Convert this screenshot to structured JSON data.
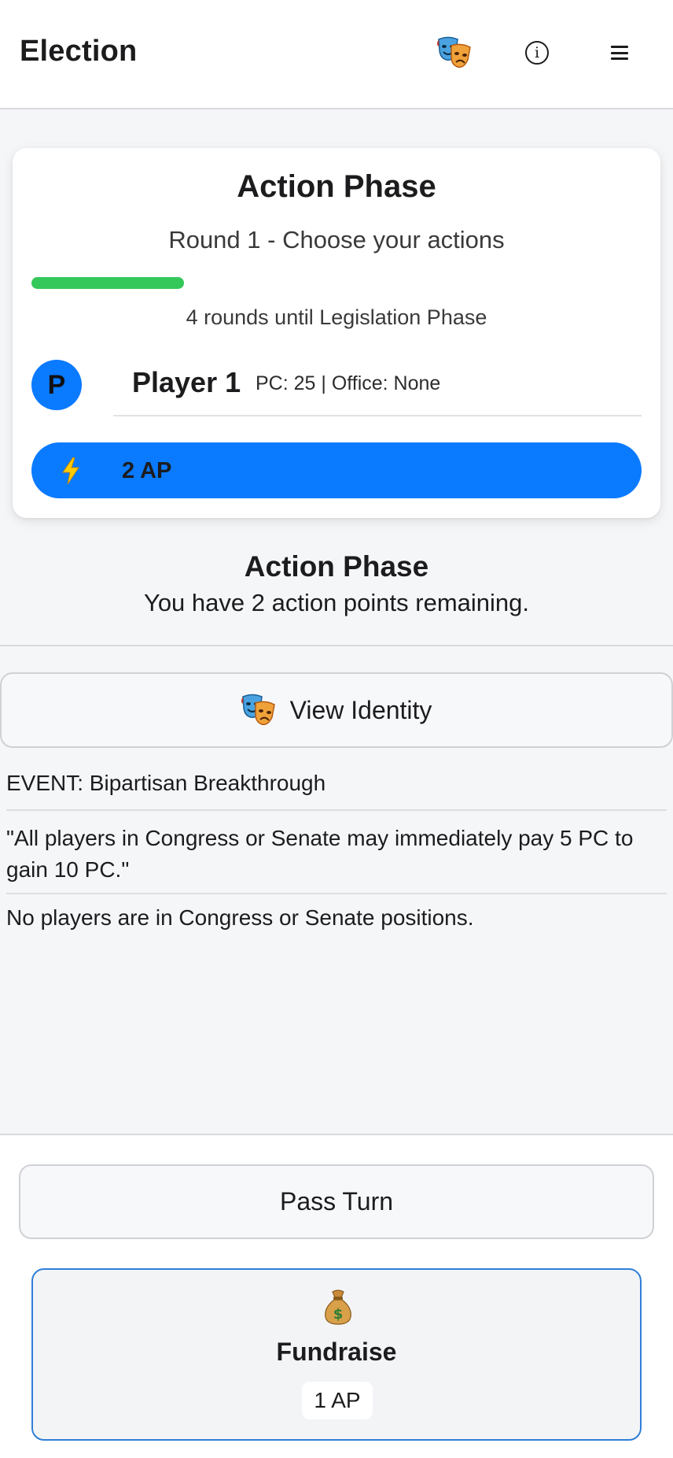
{
  "header": {
    "title": "Election",
    "identity_icon": "theater-masks-icon",
    "info_icon": "info-icon",
    "menu_icon": "menu-icon"
  },
  "status_card": {
    "phase_title": "Action Phase",
    "round_text": "Round 1 - Choose your actions",
    "progress_fraction": 0.25,
    "rounds_until": "4 rounds until Legislation Phase",
    "player": {
      "avatar_letter": "P",
      "name": "Player 1",
      "stats": "PC: 25 | Office: None"
    },
    "ap_label": "2 AP"
  },
  "action_section": {
    "heading": "Action Phase",
    "subtext": "You have 2 action points remaining."
  },
  "identity_button": {
    "label": "View Identity"
  },
  "event": {
    "title": "EVENT: Bipartisan Breakthrough",
    "quote": "\"All players in Congress or Senate may immediately pay 5 PC to gain 10 PC.\"",
    "note": "No players are in Congress or Senate positions."
  },
  "bottom": {
    "pass_label": "Pass Turn",
    "actions": [
      {
        "name": "Fundraise",
        "cost": "1 AP",
        "icon": "money-bag-icon"
      }
    ]
  },
  "colors": {
    "accent": "#0a7aff",
    "progress": "#34c759",
    "selected_border": "#2f7fd8"
  }
}
